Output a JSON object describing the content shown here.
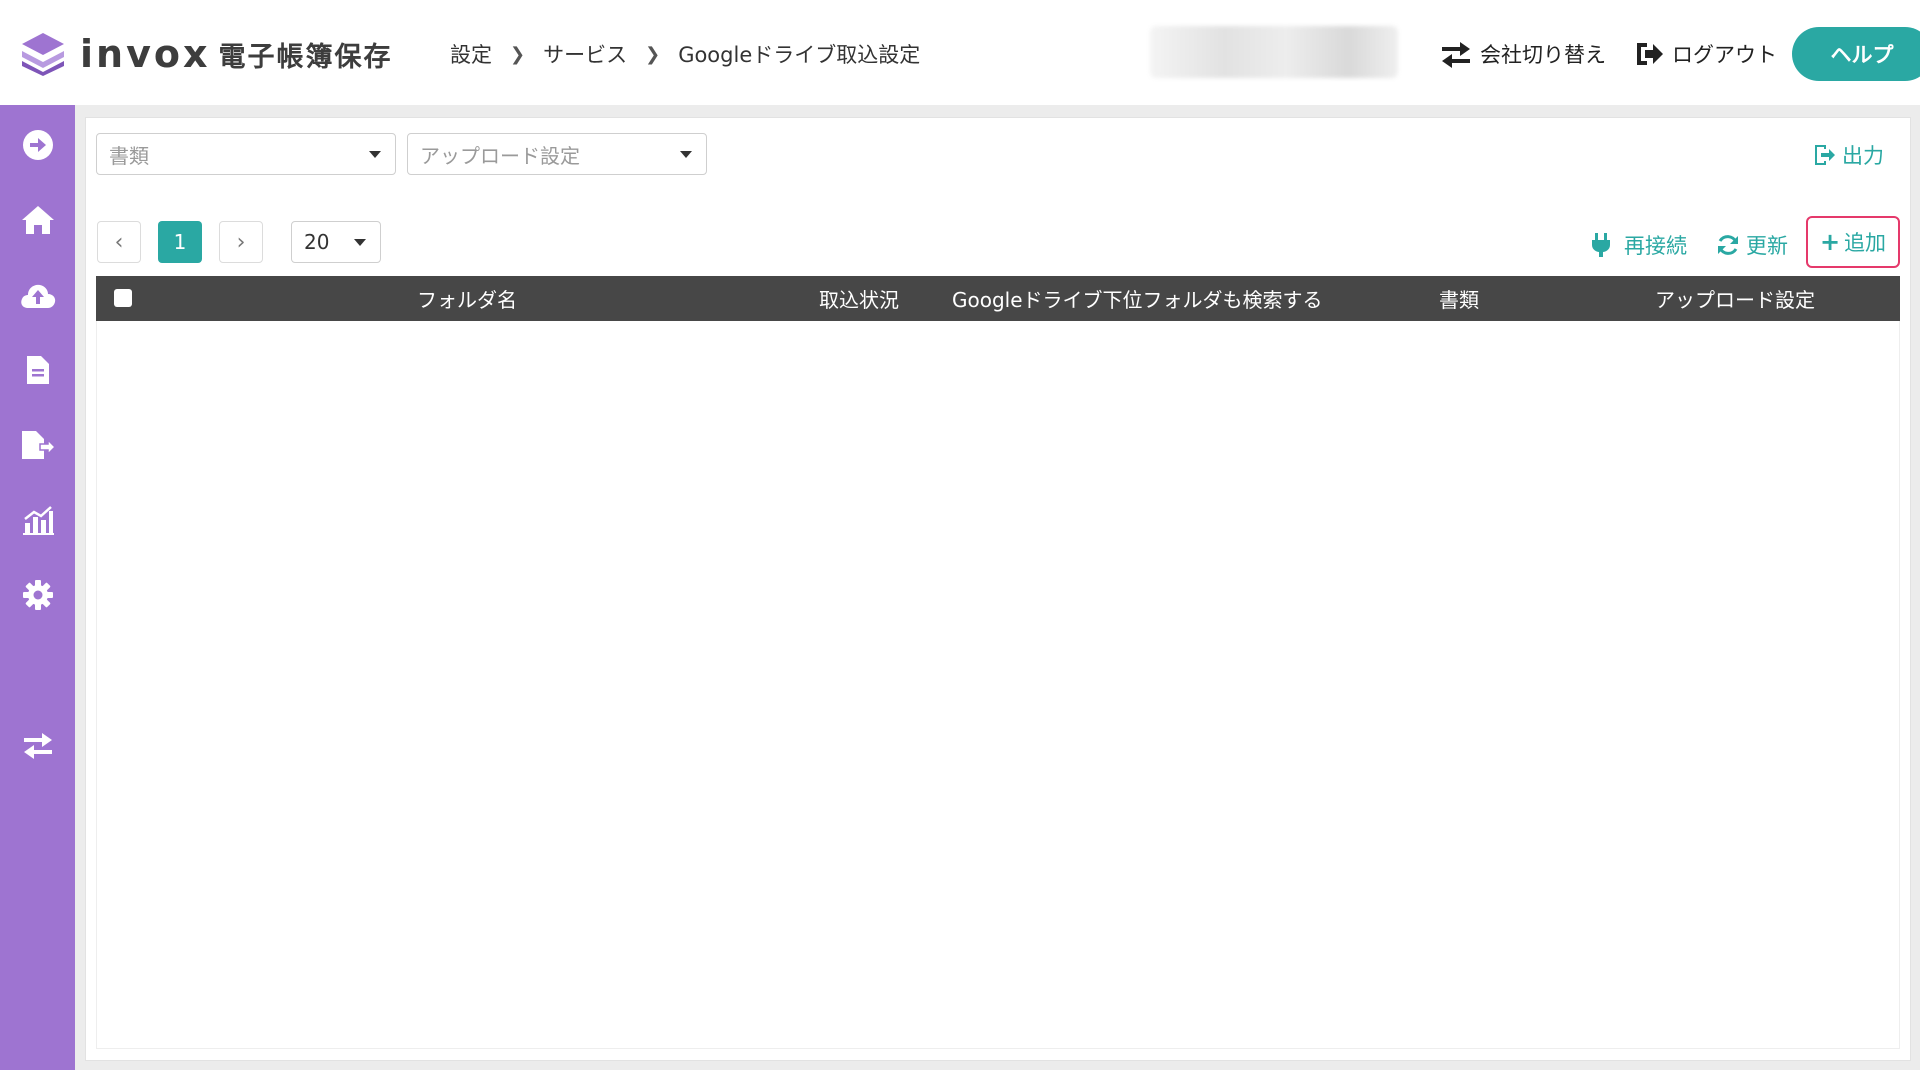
{
  "header": {
    "logo_text": "invox",
    "logo_subtitle": "電子帳簿保存",
    "breadcrumb": [
      "設定",
      "サービス",
      "Googleドライブ取込設定"
    ],
    "switch_company_label": "会社切り替え",
    "logout_label": "ログアウト",
    "help_label": "ヘルプ"
  },
  "sidebar": {
    "items": [
      "arrow-circle-right-icon",
      "home-icon",
      "cloud-upload-icon",
      "document-icon",
      "document-export-icon",
      "chart-icon",
      "gear-icon",
      "switch-icon"
    ]
  },
  "filters": {
    "document_placeholder": "書類",
    "upload_setting_placeholder": "アップロード設定"
  },
  "toolbar": {
    "export_label": "出力",
    "reconnect_label": "再接続",
    "refresh_label": "更新",
    "add_label": "追加"
  },
  "pagination": {
    "current_page": "1",
    "page_size": "20"
  },
  "table": {
    "columns": [
      "フォルダ名",
      "取込状況",
      "Googleドライブ下位フォルダも検索する",
      "書類",
      "アップロード設定"
    ],
    "rows": []
  },
  "colors": {
    "accent": "#2aa8a3",
    "sidebar": "#9e74d1",
    "table_header": "#474747",
    "highlight": "#e5396b"
  }
}
